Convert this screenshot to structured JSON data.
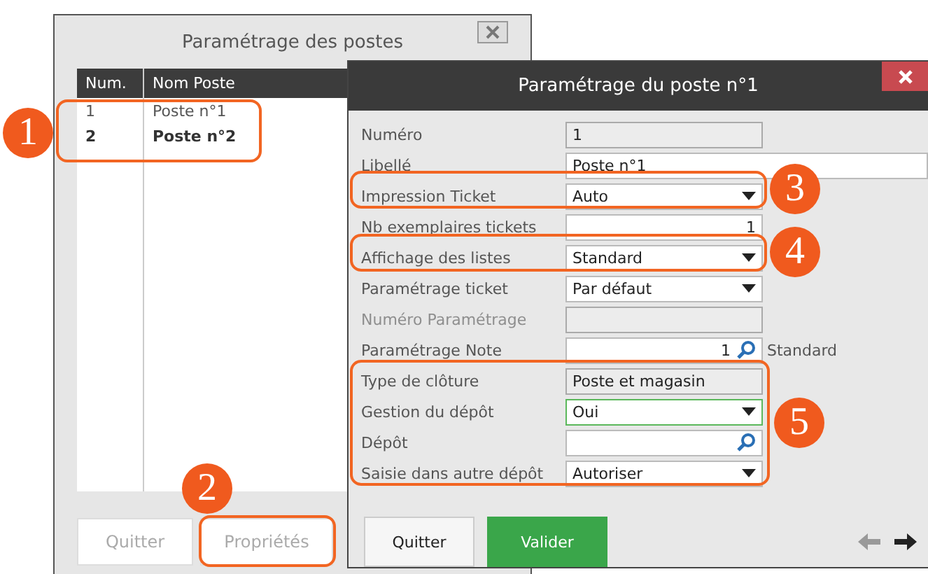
{
  "back_window": {
    "title": "Paramétrage des postes",
    "table": {
      "columns": [
        "Num.",
        "Nom Poste"
      ],
      "rows": [
        {
          "cells": [
            "1",
            "Poste n°1"
          ],
          "selected": false
        },
        {
          "cells": [
            "2",
            "Poste n°2"
          ],
          "selected": true
        }
      ]
    },
    "buttons": [
      {
        "label": "Quitter",
        "disabled": true
      },
      {
        "label": "Propriétés",
        "disabled": true
      }
    ]
  },
  "dialog": {
    "title": "Paramétrage du poste n°1",
    "fields": [
      {
        "label": "Numéro",
        "kind": "readonly",
        "value": "1",
        "disabled": false,
        "focused": false
      },
      {
        "label": "Libellé",
        "kind": "text",
        "value": "Poste n°1",
        "disabled": false,
        "focused": false
      },
      {
        "label": "Impression Ticket",
        "kind": "select",
        "value": "Auto",
        "disabled": false,
        "focused": false
      },
      {
        "label": "Nb exemplaires tickets",
        "kind": "number",
        "value": "1",
        "disabled": false,
        "focused": false
      },
      {
        "label": "Affichage des listes",
        "kind": "select",
        "value": "Standard",
        "disabled": false,
        "focused": false
      },
      {
        "label": "Paramétrage ticket",
        "kind": "select",
        "value": "Par défaut",
        "disabled": false,
        "focused": false
      },
      {
        "label": "Numéro Paramétrage",
        "kind": "readonly",
        "disabled": true,
        "focused": false
      },
      {
        "label": "Paramétrage Note",
        "kind": "lookup",
        "value": "1",
        "suffix": "Standard",
        "disabled": false,
        "focused": false
      },
      {
        "label": "Type de clôture",
        "kind": "readonly",
        "value": "Poste et magasin",
        "disabled": false,
        "focused": false
      },
      {
        "label": "Gestion du dépôt",
        "kind": "select",
        "value": "Oui",
        "disabled": false,
        "focused": true
      },
      {
        "label": "Dépôt",
        "kind": "lookup",
        "disabled": false,
        "focused": false
      },
      {
        "label": "Saisie dans autre dépôt",
        "kind": "select",
        "value": "Autoriser",
        "disabled": false,
        "focused": false
      }
    ],
    "buttons": [
      {
        "label": "Quitter",
        "kind": "secondary"
      },
      {
        "label": "Valider",
        "kind": "primary"
      }
    ],
    "nav": [
      {
        "kind": "previous",
        "disabled": true
      },
      {
        "kind": "next",
        "disabled": false
      }
    ]
  },
  "callouts": [
    {
      "number": "1"
    },
    {
      "number": "2"
    },
    {
      "number": "3"
    },
    {
      "number": "4"
    },
    {
      "number": "5"
    }
  ]
}
